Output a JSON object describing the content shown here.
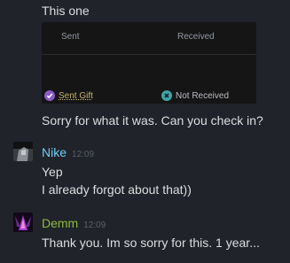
{
  "messages": {
    "top_text": "This one",
    "sorry_text": "Sorry for what it was. Can you check in?"
  },
  "trade": {
    "sent_header": "Sent",
    "received_header": "Received",
    "sent_link": "Sent Gift",
    "not_received": "Not Received",
    "sent_icon": "check-icon",
    "received_icon": "close-icon",
    "sent_color": "#8c5cc6",
    "received_color": "#3fa3a6"
  },
  "group1": {
    "name": "Nike",
    "time": "12:09",
    "lines": [
      "Yep",
      "I already forgot about that))"
    ],
    "name_color": "#6dcff6"
  },
  "group2": {
    "name": "Demm",
    "time": "12:09",
    "lines": [
      "Thank you. Im so sorry for this. 1 year..."
    ],
    "name_color": "#90ba3c"
  }
}
